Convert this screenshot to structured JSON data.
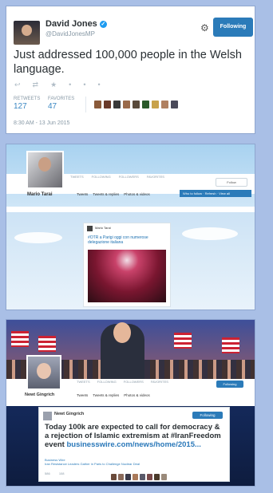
{
  "tweet1": {
    "name": "David Jones",
    "handle": "@DavidJonesMP",
    "follow_label": "Following",
    "text": "Just addressed 100,000 people in the Welsh language.",
    "retweets_label": "RETWEETS",
    "retweets": "127",
    "favorites_label": "FAVORITES",
    "favorites": "47",
    "timestamp": "8:30 AM - 13 Jun 2015"
  },
  "tweet2": {
    "name": "Mario Tarai",
    "tabs": [
      "Tweets",
      "Tweets & replies",
      "Photos & videos"
    ],
    "stats": [
      "TWEETS",
      "FOLLOWING",
      "FOLLOWERS",
      "FAVORITES"
    ],
    "follow_label": "Follow",
    "card_text": "#OTR a Parigi oggi con numerose delegazione italiana",
    "bluebar_text": "Who to follow · Refresh · View all"
  },
  "tweet3": {
    "name": "Newt Gingrich",
    "tabs": [
      "Tweets",
      "Tweets & replies",
      "Photos & videos"
    ],
    "stats": [
      "TWEETS",
      "FOLLOWING",
      "FOLLOWERS",
      "FAVORITES"
    ],
    "follow_label": "Following",
    "card_name": "Newt Gingrich",
    "card_follow": "Following",
    "card_text": "Today 100k are expected to call for democracy & a rejection of Islamic extremism at #IranFreedom event",
    "card_link": "businesswire.com/news/home/2015...",
    "card_source": "Business Wire",
    "card_headline": "Iran Resistance Leaders Gather in Paris to Challenge Nuclear Deal",
    "retweets": "586",
    "favorites": "108"
  }
}
